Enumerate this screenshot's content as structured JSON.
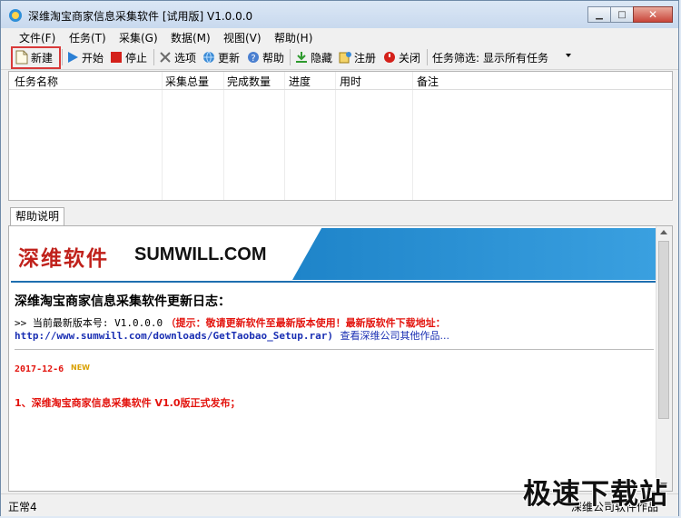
{
  "window": {
    "title": "深维淘宝商家信息采集软件 [试用版] V1.0.0.0"
  },
  "menu": [
    "文件(F)",
    "任务(T)",
    "采集(G)",
    "数据(M)",
    "视图(V)",
    "帮助(H)"
  ],
  "toolbar": {
    "new": "新建",
    "start": "开始",
    "stop": "停止",
    "options": "选项",
    "update": "更新",
    "help": "帮助",
    "hide": "隐藏",
    "register": "注册",
    "close": "关闭",
    "filter_label": "任务筛选:",
    "filter_value": "显示所有任务"
  },
  "table": {
    "columns": [
      "任务名称",
      "采集总量",
      "完成数量",
      "进度",
      "用时",
      "备注"
    ],
    "rows": []
  },
  "tabs": [
    "帮助说明"
  ],
  "help": {
    "banner_cn": "深维软件",
    "banner_en": "SUMWILL.COM",
    "log_title": "深维淘宝商家信息采集软件更新日志：",
    "version_prefix": ">> 当前最新版本号: V1.0.0.0",
    "version_tip": "（提示：敬请更新软件至最新版本使用！最新版软件下载地址：",
    "download_url": "http://www.sumwill.com/downloads/GetTaobao_Setup.rar)",
    "more_link": "查看深维公司其他作品...",
    "date": "2017-12-6",
    "new_badge": "NEW",
    "release_note": "1、深维淘宝商家信息采集软件 V1.0版正式发布；"
  },
  "status": {
    "left": "正常4",
    "right": "深维公司软件作品"
  },
  "watermark": "极速下载站",
  "colors": {
    "accent_red": "#e3140e",
    "link_blue": "#1a2fb3",
    "banner_blue": "#1e84c9"
  }
}
